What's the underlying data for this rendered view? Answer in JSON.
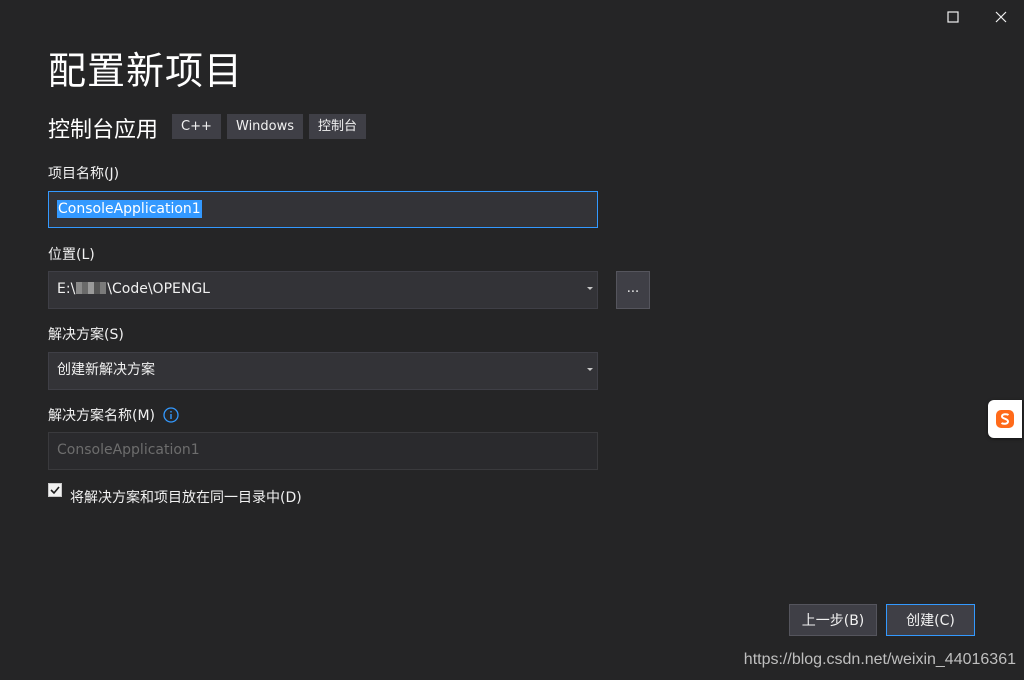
{
  "window": {
    "maximize_icon": "maximize-icon",
    "close_icon": "close-icon"
  },
  "header": {
    "title": "配置新项目",
    "template_name": "控制台应用",
    "tags": [
      "C++",
      "Windows",
      "控制台"
    ]
  },
  "form": {
    "project_name_label": "项目名称(J)",
    "project_name_value": "ConsoleApplication1",
    "location_label": "位置(L)",
    "location_value_prefix": "E:\\",
    "location_value_suffix": "\\Code\\OPENGL",
    "browse_label": "...",
    "solution_label": "解决方案(S)",
    "solution_value": "创建新解决方案",
    "solution_name_label": "解决方案名称(M)",
    "solution_name_placeholder": "ConsoleApplication1",
    "same_dir_label": "将解决方案和项目放在同一目录中(D)",
    "same_dir_checked": true
  },
  "footer": {
    "back_label": "上一步(B)",
    "create_label": "创建(C)"
  },
  "watermark": "https://blog.csdn.net/weixin_44016361",
  "colors": {
    "background": "#252526",
    "accent": "#3399ff",
    "field_bg": "#333337",
    "tag_bg": "#3f3f46"
  }
}
